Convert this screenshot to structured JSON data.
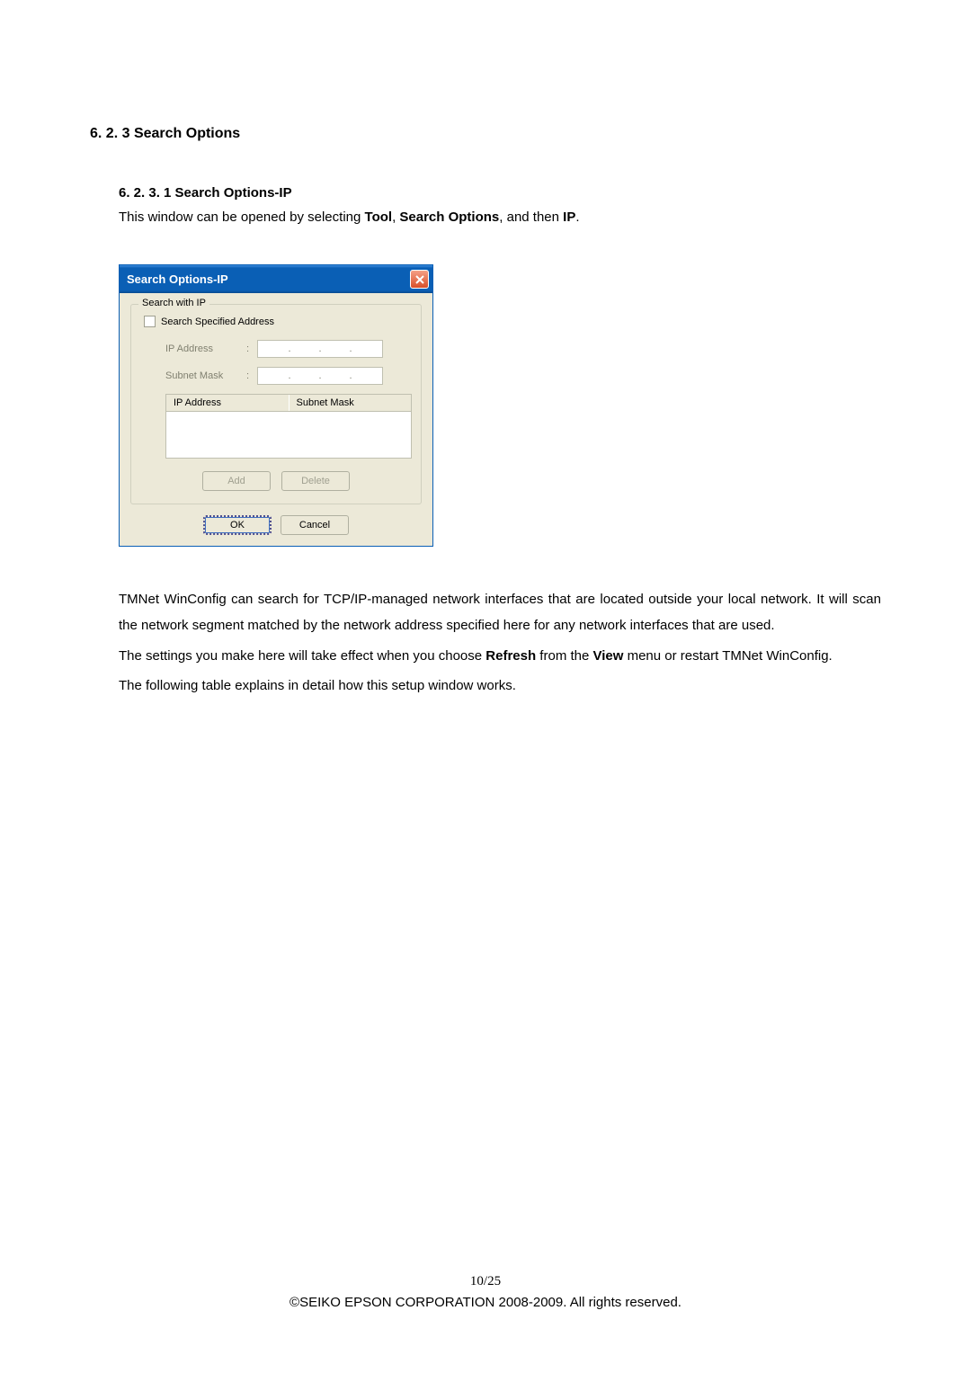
{
  "section": {
    "number": "6. 2. 3",
    "title": "Search Options"
  },
  "subsection": {
    "number": "6. 2. 3. 1",
    "title": "Search Options-IP",
    "intro_prefix": "This window can be opened by selecting ",
    "intro_tool": "Tool",
    "intro_sep1": ", ",
    "intro_searchopt": "Search Options",
    "intro_sep2": ", and then ",
    "intro_ip": "IP",
    "intro_period": "."
  },
  "dialog": {
    "title": "Search Options-IP",
    "groupbox_title": "Search with IP",
    "checkbox_label": "Search Specified Address",
    "ip_label": "IP Address",
    "subnet_label": "Subnet Mask",
    "colon": ":",
    "dot": ".",
    "table_col1": "IP Address",
    "table_col2": "Subnet Mask",
    "add_btn": "Add",
    "delete_btn": "Delete",
    "ok_btn": "OK",
    "cancel_btn": "Cancel"
  },
  "paragraphs": {
    "p1": "TMNet WinConfig can search for TCP/IP-managed network interfaces that are located outside your local network. It will scan the network segment matched by the network address specified here for any network interfaces that are used.",
    "p2_prefix": "The settings you make here will take effect when you choose ",
    "p2_refresh": "Refresh",
    "p2_mid": " from the ",
    "p2_view": "View",
    "p2_suffix": " menu or restart TMNet WinConfig.",
    "p3": "The following table explains in detail how this setup window works."
  },
  "footer": {
    "pagenum": "10/25",
    "copyright": "©SEIKO EPSON CORPORATION 2008-2009. All rights reserved."
  }
}
